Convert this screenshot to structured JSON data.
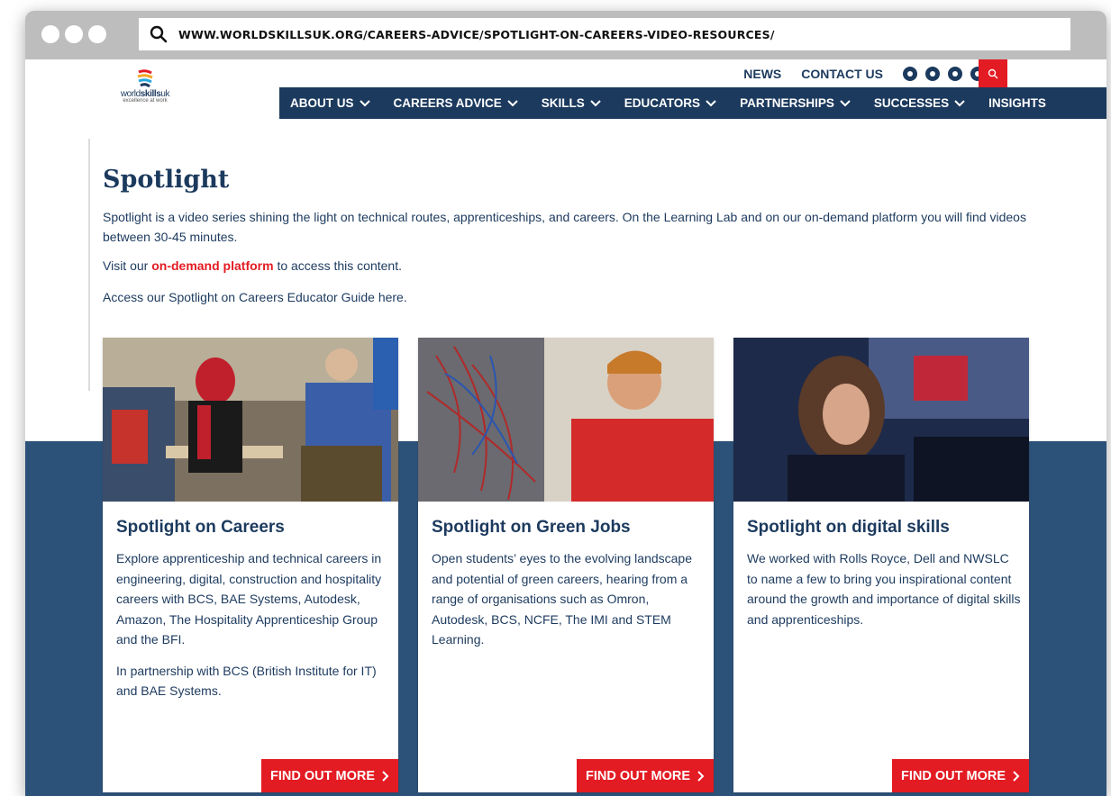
{
  "browser": {
    "url": "WWW.WORLDSKILLSUK.ORG/CAREERS-ADVICE/SPOTLIGHT-ON-CAREERS-VIDEO-RESOURCES/",
    "url_icon": "search-icon"
  },
  "header": {
    "logo": {
      "word_pre": "world",
      "word_bold": "skills",
      "word_post": "uk",
      "tagline": "excellence at work"
    },
    "util_links": [
      "NEWS",
      "CONTACT US"
    ],
    "socials": [
      "facebook-icon",
      "instagram-icon",
      "twitter-icon",
      "youtube-icon",
      "linkedin-icon"
    ],
    "search_icon": "search-icon",
    "nav": [
      {
        "label": "ABOUT US",
        "dropdown": true
      },
      {
        "label": "CAREERS ADVICE",
        "dropdown": true
      },
      {
        "label": "SKILLS",
        "dropdown": true
      },
      {
        "label": "EDUCATORS",
        "dropdown": true
      },
      {
        "label": "PARTNERSHIPS",
        "dropdown": true
      },
      {
        "label": "SUCCESSES",
        "dropdown": true
      },
      {
        "label": "INSIGHTS",
        "dropdown": false
      }
    ]
  },
  "main": {
    "title": "Spotlight",
    "intro": "Spotlight is a video series shining the light on technical routes, apprenticeships, and careers. On the Learning Lab and on our on-demand platform you will find videos between 30-45 minutes.",
    "visit_pre": "Visit our ",
    "visit_link": "on-demand platform",
    "visit_post": " to access this content.",
    "guide": "Access our Spotlight on Careers Educator Guide here."
  },
  "cards": [
    {
      "title": "Spotlight on Careers",
      "paragraphs": [
        "Explore apprenticeship and technical careers in engineering, digital, construction and hospitality careers with BCS, BAE Systems, Autodesk, Amazon, The Hospitality Apprenticeship Group and the BFI.",
        "In partnership with BCS (British Institute for IT) and BAE Systems."
      ],
      "button": "FIND OUT MORE"
    },
    {
      "title": "Spotlight on Green Jobs",
      "paragraphs": [
        "Open students’ eyes to the evolving landscape and potential of green careers, hearing from a range of organisations such as Omron, Autodesk, BCS, NCFE, The IMI and STEM Learning."
      ],
      "button": "FIND OUT MORE"
    },
    {
      "title": "Spotlight on digital skills",
      "paragraphs": [
        "We worked with Rolls Royce, Dell and NWSLC to name a few to bring you inspirational content around the growth and importance of digital skills and apprenticeships."
      ],
      "button": "FIND OUT MORE"
    }
  ],
  "colors": {
    "navy": "#1c3a5e",
    "band_blue": "#2d5279",
    "accent_red": "#e31b23",
    "frame_grey": "#bdbdbd"
  }
}
